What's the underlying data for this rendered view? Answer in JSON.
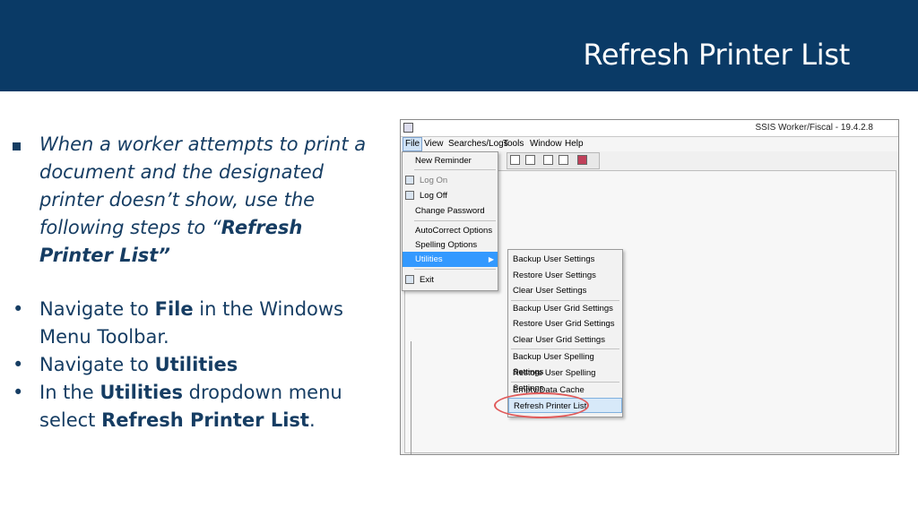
{
  "slide": {
    "title": "Refresh Printer List",
    "intro": {
      "part1": "When a worker attempts to print a document and the designated printer doesn’t show, use the following steps to “",
      "bold": "Refresh Printer List”"
    },
    "steps": [
      {
        "pre": "Navigate to ",
        "bold": "File",
        "post": " in the Windows Menu Toolbar."
      },
      {
        "pre": "Navigate to ",
        "bold": "Utilities",
        "post": ""
      },
      {
        "pre": "In the ",
        "bold": "Utilities",
        "post": " dropdown menu select ",
        "bold2": "Refresh Printer List",
        "post2": "."
      }
    ]
  },
  "app": {
    "window_title": "SSIS Worker/Fiscal - 19.4.2.8",
    "menus": [
      "File",
      "View",
      "Searches/Logs",
      "Tools",
      "Window",
      "Help"
    ],
    "file_menu": {
      "items": [
        "New Reminder",
        "Log On",
        "Log Off",
        "Change Password",
        "AutoCorrect Options",
        "Spelling Options",
        "Utilities",
        "Exit"
      ]
    },
    "utilities_menu": {
      "items": [
        "Backup User Settings",
        "Restore User Settings",
        "Clear User Settings",
        "Backup User Grid Settings",
        "Restore User Grid Settings",
        "Clear User Grid Settings",
        "Backup User Spelling Settings",
        "Restore User Spelling Settings",
        "Empty Data Cache",
        "Refresh Printer List"
      ]
    },
    "colors": {
      "header": "#0a3a66",
      "highlight": "#3399ff",
      "annotation_circle": "#e05a5a"
    },
    "icons": {
      "submenu_arrow": "chevron-right-icon",
      "app": "app-icon"
    }
  }
}
